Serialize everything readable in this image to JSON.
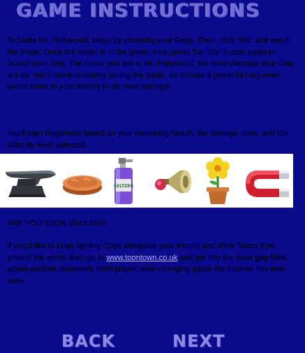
{
  "title": "GAME INSTRUCTIONS",
  "paragraphs": {
    "p1": "To battle Mr. Hollywood, begin by choosing your Gags. Then, click \"Go\" and watch the meter. Once the meter is in the green area, press the \"Go\" button again to launch your Gag. The closer you are to Mr. Hollywood, the more damage your Gag will do.  You'll move randomly during the battle, so choose a powerful Gag when you're close to your enemy to do more damage.",
    "p2": "You'll earn Regorents based on your remaining health, the damage done, and the difficulty level selected.",
    "p3": "ARE YOU TOON ENOUGH?",
    "p4_before": "If you'd like to keep fighting Cogs alongside your friends and other Toons from around the world, then go to ",
    "p4_link": "www.toontown.co.uk",
    "p4_after": " and get into the most gag-filled, action-packed, massively multi-player, ever-changing game the Internet has ever seen."
  },
  "gags": {
    "seltzer_label": "SELTZER",
    "items": [
      {
        "name": "anvil",
        "icon": "anvil-icon"
      },
      {
        "name": "cream pie",
        "icon": "pie-icon"
      },
      {
        "name": "seltzer bottle",
        "icon": "seltzer-bottle-icon"
      },
      {
        "name": "foghorn",
        "icon": "foghorn-icon"
      },
      {
        "name": "squirting flower",
        "icon": "flower-icon"
      },
      {
        "name": "magnet",
        "icon": "magnet-icon"
      }
    ]
  },
  "nav": {
    "back_label": "BACK",
    "next_label": "NEXT"
  },
  "colors": {
    "background": "#0a0a8a",
    "heading": "#6f6fd6",
    "link": "#b0b0ff",
    "body_text": "#000000"
  }
}
